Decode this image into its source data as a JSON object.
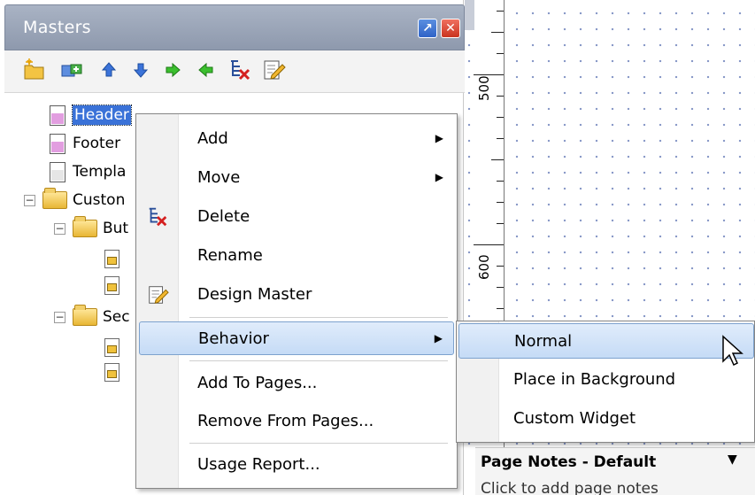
{
  "panel": {
    "title": "Masters"
  },
  "toolbar": {
    "tools": [
      "add-folder-icon",
      "add-master-icon",
      "move-up-icon",
      "move-down-icon",
      "indent-icon",
      "outdent-icon",
      "delete-icon",
      "edit-icon"
    ]
  },
  "tree": {
    "header": "Header",
    "footer": "Footer",
    "template": "Templa",
    "custom": "Custon",
    "buttons": "But",
    "section": "Sec"
  },
  "ruler": {
    "mark_500": "500",
    "mark_600": "600"
  },
  "notes": {
    "title": "Page Notes - Default",
    "caret": "▼",
    "hint": "Click to add page notes"
  },
  "context_menu": {
    "add": "Add",
    "move": "Move",
    "delete": "Delete",
    "rename": "Rename",
    "design_master": "Design Master",
    "behavior": "Behavior",
    "add_to_pages": "Add To Pages...",
    "remove_from_pages": "Remove From Pages...",
    "usage_report": "Usage Report..."
  },
  "submenu": {
    "normal": "Normal",
    "place_in_background": "Place in Background",
    "custom_widget": "Custom Widget"
  },
  "colors": {
    "selection": "#3a72d8",
    "menu_highlight": "#c5dbf6",
    "title_bar": "#8e99ad"
  }
}
